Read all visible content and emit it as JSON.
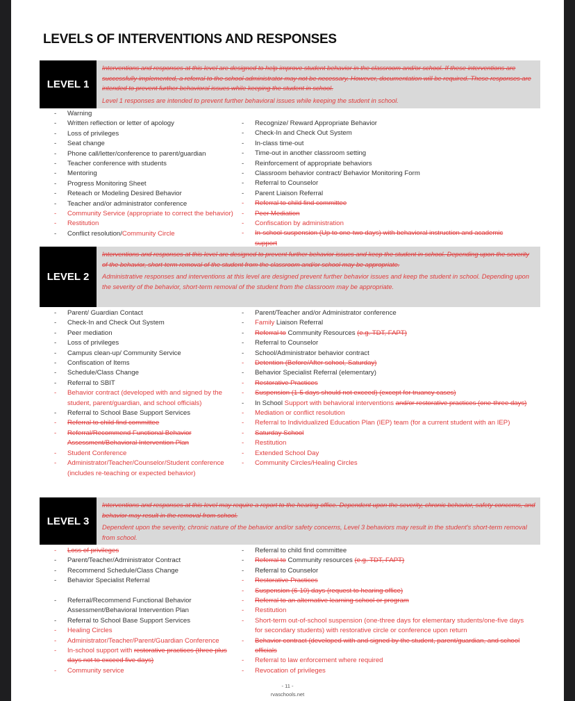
{
  "title": "LEVELS OF INTERVENTIONS AND RESPONSES",
  "levels": [
    {
      "label": "LEVEL 1",
      "desc_struck": "Interventions and responses at this level are designed to help improve student behavior in the classroom and/or school. If these interventions are successfully implemented, a referral to the school administrator may not be necessary. However, documentation will be required. These responses are intended to prevent further behavioral issues while keeping the student in school.",
      "desc_new": "Level 1 responses are intended to prevent further behavioral issues while keeping the student in school.",
      "left": [
        {
          "text": "Warning"
        },
        {
          "text": "Written reflection or letter of apology"
        },
        {
          "text": "Loss of privileges"
        },
        {
          "text": "Seat change"
        },
        {
          "text": "Phone call/letter/conference to parent/guardian"
        },
        {
          "text": "Teacher conference with students"
        },
        {
          "text": "Mentoring"
        },
        {
          "text": "Progress Monitoring Sheet"
        },
        {
          "text": "Reteach or Modeling Desired Behavior"
        },
        {
          "text": "Teacher and/or administrator conference"
        },
        {
          "text": "Community Service (appropriate to correct the behavior)",
          "style": "red"
        },
        {
          "text": "Restitution",
          "style": "red"
        },
        {
          "text": "Conflict resolution/",
          "suffix": "Community Circle"
        }
      ],
      "right": [
        {
          "text": "Recognize/ Reward Appropriate Behavior"
        },
        {
          "text": "Check-In and Check Out System"
        },
        {
          "text": "In-class time-out"
        },
        {
          "text": "Time-out in another classroom setting"
        },
        {
          "text": "Reinforcement of appropriate behaviors"
        },
        {
          "text": "Classroom behavior contract/ Behavior Monitoring Form"
        },
        {
          "text": "Referral to Counselor"
        },
        {
          "text": "Parent Liaison Referral"
        },
        {
          "text": "Referral to child find committee",
          "style": "struck"
        },
        {
          "text": "Peer Mediation",
          "style": "struck"
        },
        {
          "text": "Confiscation by administration",
          "style": "red"
        },
        {
          "text": "In-school suspension (Up to one-two days) with behavioral instruction and academic support",
          "style": "struck"
        }
      ]
    },
    {
      "label": "LEVEL 2",
      "desc_struck": "Interventions and responses at this level are designed to prevent further behavior issues and keep the student in school. Depending upon the severity of the behavior, short-term removal of the student from the classroom and/or school may be appropriate.",
      "desc_new": "Administrative responses and interventions at this level are designed prevent further behavior issues and keep the student in school. Depending upon the severity of the behavior, short-term removal of the student from the classroom may be appropriate.",
      "left": [
        {
          "text": "Parent/ Guardian Contact"
        },
        {
          "text": "Check-In and Check Out System"
        },
        {
          "text": "Peer mediation"
        },
        {
          "text": "Loss of privileges"
        },
        {
          "text": "Campus clean-up/ Community Service"
        },
        {
          "text": "Confiscation of Items"
        },
        {
          "text": "Schedule/Class Change"
        },
        {
          "text": "Referral to SBIT"
        },
        {
          "text": "Behavior contract (developed with and signed by the student, parent/guardian, and school officials)",
          "style": "red"
        },
        {
          "text": "Referral to School Base Support Services"
        },
        {
          "text": "Referral to child find committee",
          "style": "struck"
        },
        {
          "text": "Referral/Recommend Functional Behavior Assessment/Behavioral Intervention Plan",
          "style": "struck"
        },
        {
          "text": "Student Conference",
          "style": "red"
        },
        {
          "text": "Administrator/Teacher/Counselor/Student conference (includes re-teaching or expected behavior)",
          "style": "red"
        }
      ],
      "right": [
        {
          "text": "Parent/Teacher and/or Administrator conference"
        },
        {
          "prefix": "Family",
          "text": " Liaison Referral"
        },
        {
          "prefix_struck": "Referral to",
          "text": " Community Resources ",
          "suffix_struck": "(e.g. TDT, FAPT)"
        },
        {
          "text": "Referral to Counselor"
        },
        {
          "text": "School/Administrator behavior contract"
        },
        {
          "text": "Detention (Before/After school, Saturday)",
          "style": "struck"
        },
        {
          "text": "Behavior Specialist Referral (elementary)"
        },
        {
          "text": "Restorative Practices",
          "style": "struck"
        },
        {
          "text": "Suspension (1-5 days should not exceed) (except for truancy cases)",
          "style": "struck"
        },
        {
          "text": "In School ",
          "suffix": "Support with behavioral interventions ",
          "suffix_struck": "and/or restorative practices (one-three days)"
        },
        {
          "text": "Mediation or conflict resolution",
          "style": "red"
        },
        {
          "text": "Referral to Individualized Education Plan (IEP) team (for a current student with an IEP)",
          "style": "red"
        },
        {
          "text": "Saturday School",
          "style": "struck"
        },
        {
          "text": "Restitution",
          "style": "red"
        },
        {
          "text": "Extended School Day",
          "style": "red"
        },
        {
          "text": "Community Circles/Healing Circles",
          "style": "red"
        }
      ]
    },
    {
      "label": "LEVEL 3",
      "desc_struck": "Interventions and responses at this level may require a report to the hearing office. Dependent upon the severity, chronic behavior, safety concerns, and behavior may result in the removal from school.",
      "desc_new": "Dependent upon the severity, chronic nature of the behavior and/or safety concerns, Level 3 behaviors may result in the student's short-term removal from school.",
      "left": [
        {
          "text": "Loss of privileges",
          "style": "struck"
        },
        {
          "text": "Parent/Teacher/Administrator Contract"
        },
        {
          "text": "Recommend Schedule/Class Change"
        },
        {
          "text": "Behavior Specialist Referral"
        },
        {
          "text": "",
          "style": "spacer"
        },
        {
          "text": "Referral/Recommend Functional Behavior Assessment/Behavioral Intervention Plan"
        },
        {
          "text": " Referral to School Base Support Services"
        },
        {
          "text": "Healing Circles",
          "style": "red"
        },
        {
          "text": "Administrator/Teacher/Parent/Guardian Conference",
          "style": "red"
        },
        {
          "text": "In-school support with ",
          "style": "red",
          "suffix_struck": "restorative practices (three plus days not to exceed five days)"
        },
        {
          "text": "Community service",
          "style": "red"
        }
      ],
      "right": [
        {
          "text": "Referral to child find committee"
        },
        {
          "prefix_struck": "Referral to",
          "text": " Community resources ",
          "suffix_struck": "(e.g. TDT, FAPT)"
        },
        {
          "text": "Referral to Counselor"
        },
        {
          "text": "Restorative Practices",
          "style": "struck"
        },
        {
          "text": "Suspension (6-10) days (request to hearing office)",
          "style": "struck"
        },
        {
          "text": "Referral to an alternative learning school or program",
          "style": "struck"
        },
        {
          "text": "Restitution",
          "style": "red"
        },
        {
          "text": "Short-term out-of-school suspension (one-three days for elementary students/one-five days for secondary students) with restorative circle or conference upon return",
          "style": "red"
        },
        {
          "text": "Behavior contract (developed with and signed by the student, parent/guardian, and school officials",
          "style": "struck"
        },
        {
          "text": "Referral to law enforcement where required",
          "style": "red"
        },
        {
          "text": "Revocation of privileges",
          "style": "red"
        }
      ]
    }
  ],
  "footer": {
    "page_number": "- 11 -",
    "site": "rvaschools.net"
  }
}
